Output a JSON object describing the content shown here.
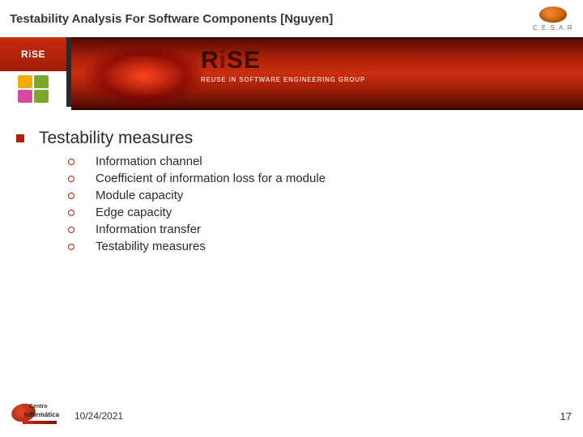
{
  "header": {
    "title": "Testability Analysis For Software Components [Nguyen]",
    "logo_cesar_label": "C.E.S.A.R"
  },
  "banner": {
    "rise_text_black": "R",
    "rise_text_orange": "i",
    "rise_text_rest": "SE",
    "tagline": "REUSE iN SOFTWARE ENGINEERING GROUP"
  },
  "content": {
    "heading": "Testability measures",
    "items": [
      "Information channel",
      "Coefficient of information loss for a module",
      "Module capacity",
      "Edge capacity",
      "Information transfer",
      "Testability measures"
    ]
  },
  "footer": {
    "cin_top": "Centro",
    "cin_bottom": "Informática",
    "date": "10/24/2021",
    "page": "17"
  }
}
